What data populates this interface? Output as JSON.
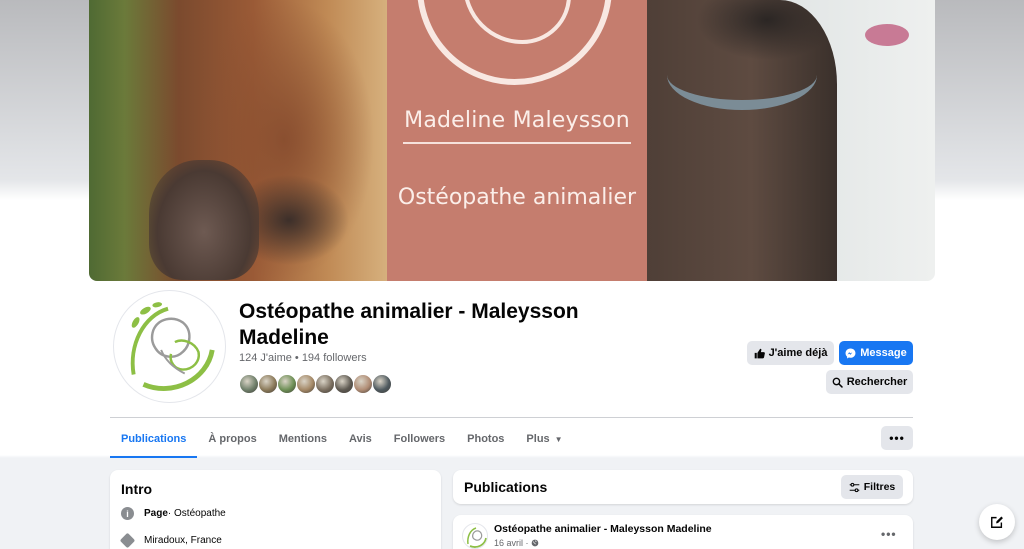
{
  "cover": {
    "name_text": "Madeline Maleysson",
    "title_text": "Ostéopathe animalier"
  },
  "page": {
    "title": "Ostéopathe animalier - Maleysson Madeline",
    "stats": "124 J'aime • 194 followers",
    "follower_avatar_colors": [
      "#6f7f6a",
      "#8b7a5a",
      "#6d8f55",
      "#a48866",
      "#7b6f60",
      "#5f5a52",
      "#b08c74",
      "#4f5a5f"
    ]
  },
  "actions": {
    "like_label": "J'aime déjà",
    "message_label": "Message",
    "search_label": "Rechercher"
  },
  "tabs": [
    {
      "label": "Publications",
      "active": true
    },
    {
      "label": "À propos",
      "active": false
    },
    {
      "label": "Mentions",
      "active": false
    },
    {
      "label": "Avis",
      "active": false
    },
    {
      "label": "Followers",
      "active": false
    },
    {
      "label": "Photos",
      "active": false
    },
    {
      "label": "Plus",
      "active": false
    }
  ],
  "more_button_label": "•••",
  "intro": {
    "title": "Intro",
    "category_label": "Page",
    "category_value": " · Ostéopathe",
    "location": "Miradoux, France"
  },
  "publications": {
    "title": "Publications",
    "filters_label": "Filtres"
  },
  "post": {
    "author": "Ostéopathe animalier - Maleysson Madeline",
    "date": "16 avril · ",
    "options_label": "•••"
  },
  "colors": {
    "accent": "#1877f2",
    "logo_green": "#8dbf45",
    "cover_card": "#c57d6e"
  },
  "icons": {
    "like": "thumbs-up-icon",
    "message": "messenger-icon",
    "search": "search-icon",
    "info": "info-icon",
    "location": "location-diamond-icon",
    "filters": "sliders-icon",
    "globe": "globe-icon",
    "compose": "compose-icon"
  }
}
